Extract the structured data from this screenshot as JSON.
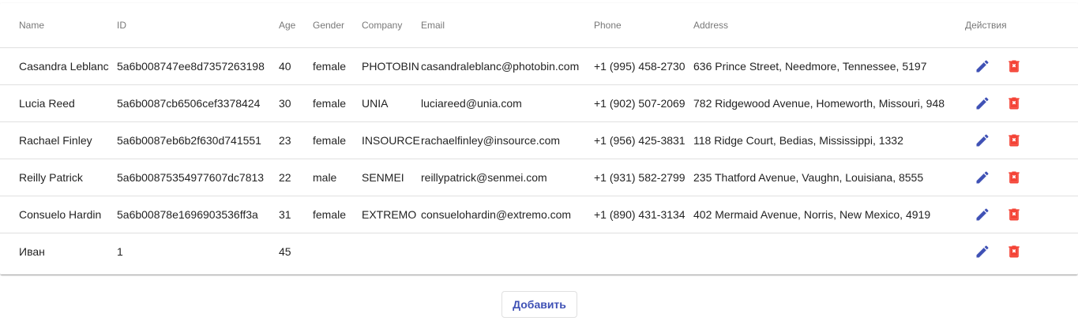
{
  "columns": {
    "name": "Name",
    "id": "ID",
    "age": "Age",
    "gender": "Gender",
    "company": "Company",
    "email": "Email",
    "phone": "Phone",
    "address": "Address",
    "actions": "Действия"
  },
  "rows": [
    {
      "name": "Casandra Leblanc",
      "id": "5a6b008747ee8d7357263198",
      "age": "40",
      "gender": "female",
      "company": "PHOTOBIN",
      "email": "casandraleblanc@photobin.com",
      "phone": "+1 (995) 458-2730",
      "address": "636 Prince Street, Needmore, Tennessee, 5197"
    },
    {
      "name": "Lucia Reed",
      "id": "5a6b0087cb6506cef3378424",
      "age": "30",
      "gender": "female",
      "company": "UNIA",
      "email": "luciareed@unia.com",
      "phone": "+1 (902) 507-2069",
      "address": "782 Ridgewood Avenue, Homeworth, Missouri, 948"
    },
    {
      "name": "Rachael Finley",
      "id": "5a6b0087eb6b2f630d741551",
      "age": "23",
      "gender": "female",
      "company": "INSOURCE",
      "email": "rachaelfinley@insource.com",
      "phone": "+1 (956) 425-3831",
      "address": "118 Ridge Court, Bedias, Mississippi, 1332"
    },
    {
      "name": "Reilly Patrick",
      "id": "5a6b00875354977607dc7813",
      "age": "22",
      "gender": "male",
      "company": "SENMEI",
      "email": "reillypatrick@senmei.com",
      "phone": "+1 (931) 582-2799",
      "address": "235 Thatford Avenue, Vaughn, Louisiana, 8555"
    },
    {
      "name": "Consuelo Hardin",
      "id": "5a6b00878e1696903536ff3a",
      "age": "31",
      "gender": "female",
      "company": "EXTREMO",
      "email": "consuelohardin@extremo.com",
      "phone": "+1 (890) 431-3134",
      "address": "402 Mermaid Avenue, Norris, New Mexico, 4919"
    },
    {
      "name": "Иван",
      "id": "1",
      "age": "45",
      "gender": "",
      "company": "",
      "email": "",
      "phone": "",
      "address": ""
    }
  ],
  "icons": {
    "edit": "pencil-icon",
    "delete": "trash-icon"
  },
  "colors": {
    "edit": "#3f51b5",
    "delete": "#f44336",
    "add_button_text": "#3f51b5"
  },
  "add_button": {
    "label": "Добавить"
  }
}
